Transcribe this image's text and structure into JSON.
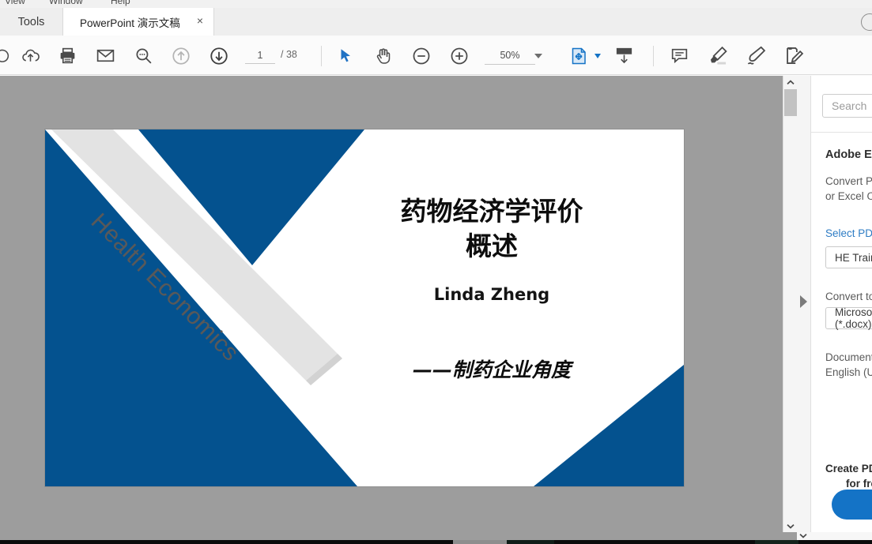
{
  "menu": {
    "items": [
      "View",
      "Window",
      "Help"
    ]
  },
  "tabbar": {
    "tools_label": "Tools",
    "document_tab": "PowerPoint 演示文稿",
    "close_label": "×",
    "help_icon": "help-circle-icon"
  },
  "toolbar": {
    "items": [
      {
        "name": "rotate-icon",
        "label": ""
      },
      {
        "name": "upload-cloud-icon",
        "label": ""
      },
      {
        "name": "print-icon",
        "label": ""
      },
      {
        "name": "email-icon",
        "label": ""
      },
      {
        "name": "search-icon",
        "label": ""
      },
      {
        "name": "previous-page-icon",
        "label": ""
      },
      {
        "name": "next-page-icon",
        "label": ""
      }
    ],
    "page_current": "1",
    "page_total": "/ 38",
    "select-tool": "cursor-arrow-icon",
    "hand-tool": "hand-icon",
    "zoom_out": "zoom-out-icon",
    "zoom_in": "zoom-in-icon",
    "zoom_level": "50%",
    "fit_page": "fit-page-icon",
    "scroll_mode": "scroll-mode-icon",
    "comment": "comment-icon",
    "highlight": "highlight-pen-icon",
    "draw": "draw-pen-icon",
    "fill_sign": "fill-and-sign-icon"
  },
  "slide": {
    "banner_text": "Health Economics",
    "title_line1": "药物经济学评价",
    "title_line2": "概述",
    "author": "Linda Zheng",
    "subtitle": "——制药企业角度",
    "accent_color": "#04528f",
    "banner_color": "#e3e3e3"
  },
  "right_panel": {
    "search_placeholder": "Search",
    "section_title": "Adobe Export PDF",
    "description_line1": "Convert PDF files to Word",
    "description_line2": "or Excel Online",
    "select_pdf_label": "Select PDF File",
    "selected_file": "HE Training.pdf",
    "convert_to_label": "Convert to",
    "convert_target": "Microsoft Word (*.docx)",
    "document_language_label": "Document Language:",
    "document_language_value": "English (U.S.) Change",
    "cta_line1": "Create PDF, edit, and more",
    "cta_line2": "for free"
  },
  "scrollbar": {
    "up_arrow": "chevron-up-icon",
    "down_arrow": "chevron-down-icon",
    "expand_panel": "panel-expand-arrow-icon"
  }
}
